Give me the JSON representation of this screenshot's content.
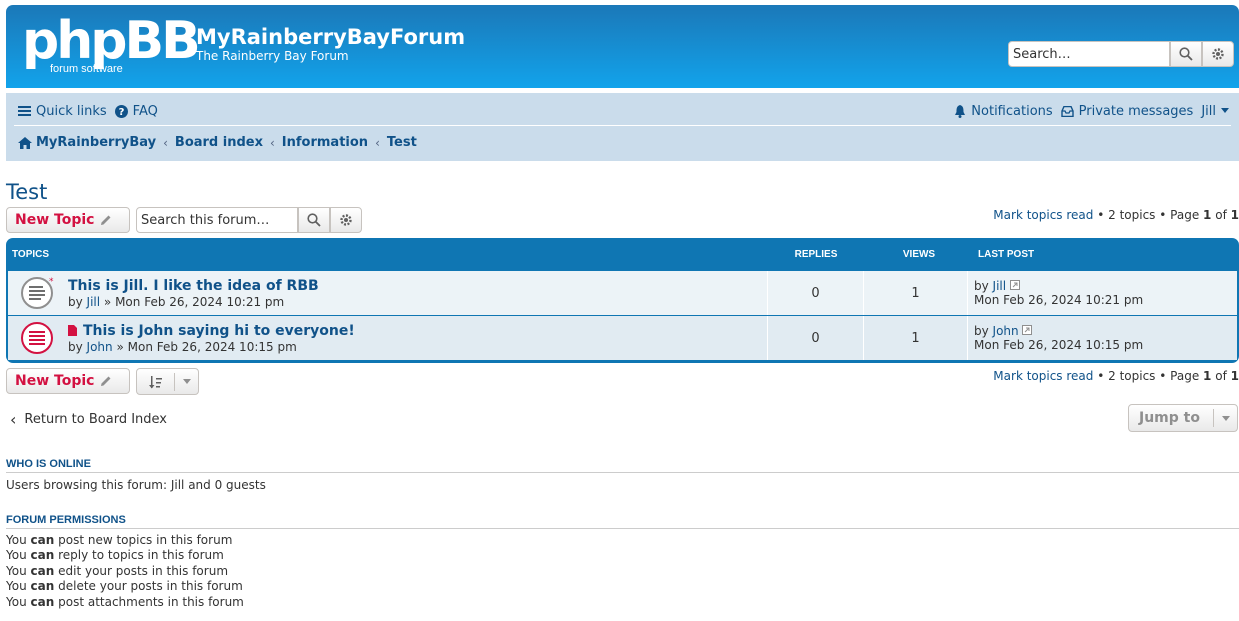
{
  "header": {
    "logo_text": "phpBB",
    "logo_sub": "forum  software",
    "site_name": "MyRainberryBayForum",
    "site_desc": "The Rainberry Bay Forum",
    "search_placeholder": "Search…"
  },
  "navbar": {
    "quick_links": "Quick links",
    "faq": "FAQ",
    "notifications": "Notifications",
    "private_messages": "Private messages",
    "user": "Jill",
    "breadcrumbs": [
      "MyRainberryBay",
      "Board index",
      "Information",
      "Test"
    ]
  },
  "page_title": "Test",
  "actions": {
    "new_topic": "New Topic",
    "forum_search_placeholder": "Search this forum…",
    "mark_read": "Mark topics read",
    "topic_count": "2 topics",
    "page_prefix": "Page",
    "page_current": "1",
    "page_of": "of",
    "page_total": "1"
  },
  "table": {
    "headers": {
      "topics": "TOPICS",
      "replies": "REPLIES",
      "views": "VIEWS",
      "last_post": "LAST POST"
    },
    "rows": [
      {
        "title": "This is Jill. I like the idea of RBB",
        "author": "Jill",
        "date": "Mon Feb 26, 2024 10:21 pm",
        "replies": "0",
        "views": "1",
        "last_by": "Jill",
        "last_date": "Mon Feb 26, 2024 10:21 pm"
      },
      {
        "title": "This is John saying hi to everyone!",
        "author": "John",
        "date": "Mon Feb 26, 2024 10:15 pm",
        "replies": "0",
        "views": "1",
        "last_by": "John",
        "last_date": "Mon Feb 26, 2024 10:15 pm"
      }
    ]
  },
  "footer": {
    "return": "Return to Board Index",
    "jump_to": "Jump to",
    "who_online_h": "WHO IS ONLINE",
    "who_online": "Users browsing this forum: Jill and 0 guests",
    "permissions_h": "FORUM PERMISSIONS",
    "permissions": [
      {
        "pre": "You",
        "can": "can",
        "post": "post new topics in this forum"
      },
      {
        "pre": "You",
        "can": "can",
        "post": "reply to topics in this forum"
      },
      {
        "pre": "You",
        "can": "can",
        "post": "edit your posts in this forum"
      },
      {
        "pre": "You",
        "can": "can",
        "post": "delete your posts in this forum"
      },
      {
        "pre": "You",
        "can": "can",
        "post": "post attachments in this forum"
      }
    ]
  },
  "colors": {
    "accent": "#105289",
    "header": "#1b78b8",
    "new_topic": "#d31141",
    "navbar": "#cadceb"
  }
}
